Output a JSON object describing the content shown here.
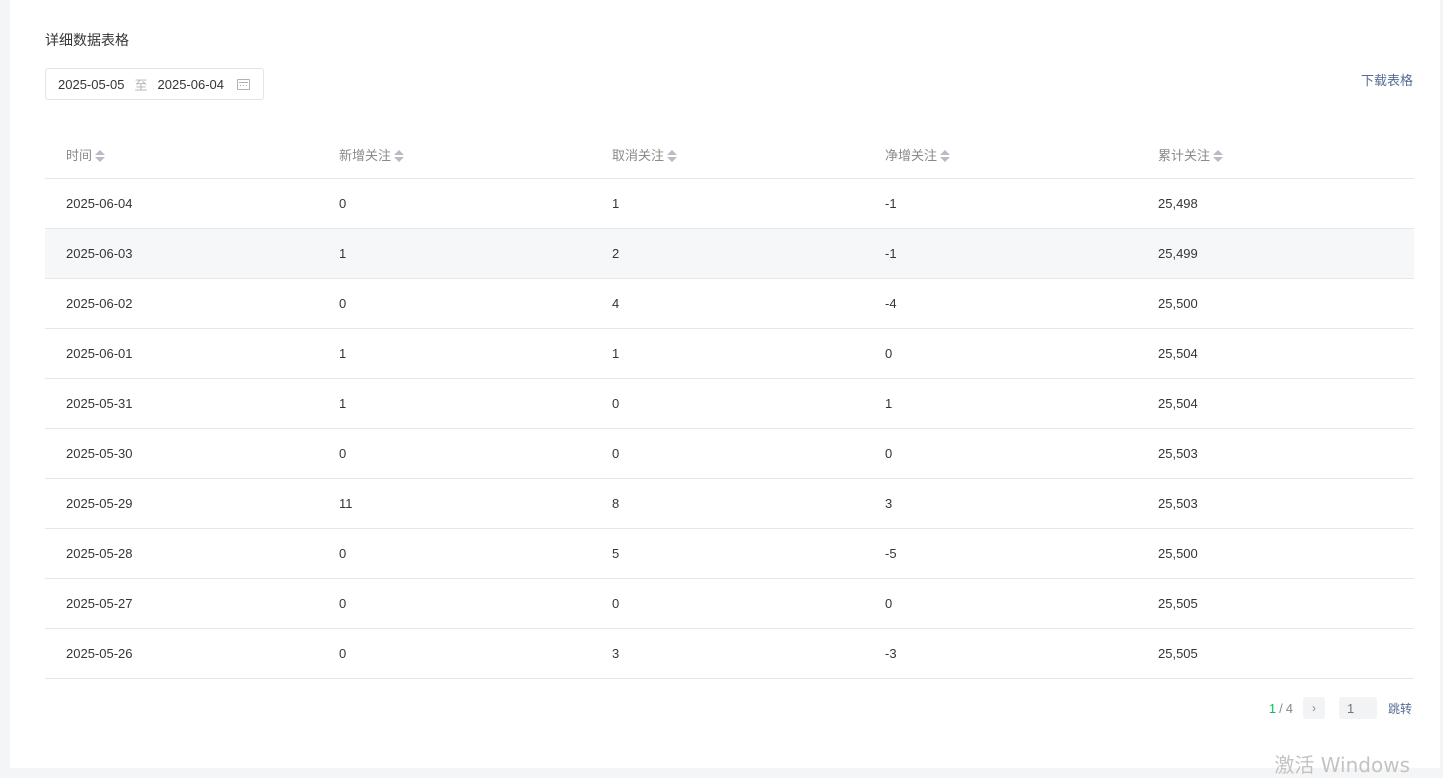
{
  "section": {
    "title": "详细数据表格"
  },
  "date_range": {
    "start": "2025-05-05",
    "separator": "至",
    "end": "2025-06-04"
  },
  "download_label": "下载表格",
  "table": {
    "columns": [
      "时间",
      "新增关注",
      "取消关注",
      "净增关注",
      "累计关注"
    ],
    "rows": [
      [
        "2025-06-04",
        "0",
        "1",
        "-1",
        "25,498"
      ],
      [
        "2025-06-03",
        "1",
        "2",
        "-1",
        "25,499"
      ],
      [
        "2025-06-02",
        "0",
        "4",
        "-4",
        "25,500"
      ],
      [
        "2025-06-01",
        "1",
        "1",
        "0",
        "25,504"
      ],
      [
        "2025-05-31",
        "1",
        "0",
        "1",
        "25,504"
      ],
      [
        "2025-05-30",
        "0",
        "0",
        "0",
        "25,503"
      ],
      [
        "2025-05-29",
        "11",
        "8",
        "3",
        "25,503"
      ],
      [
        "2025-05-28",
        "0",
        "5",
        "-5",
        "25,500"
      ],
      [
        "2025-05-27",
        "0",
        "0",
        "0",
        "25,505"
      ],
      [
        "2025-05-26",
        "0",
        "3",
        "-3",
        "25,505"
      ]
    ]
  },
  "pagination": {
    "current": "1",
    "separator": "/",
    "total": "4",
    "next_icon": "chevron-right-icon",
    "input_placeholder": "1",
    "jump_label": "跳转"
  },
  "watermark": "激活 Windows",
  "colors": {
    "accent": "#07c160",
    "link": "#576b95",
    "row_hover": "#f6f7f9"
  }
}
